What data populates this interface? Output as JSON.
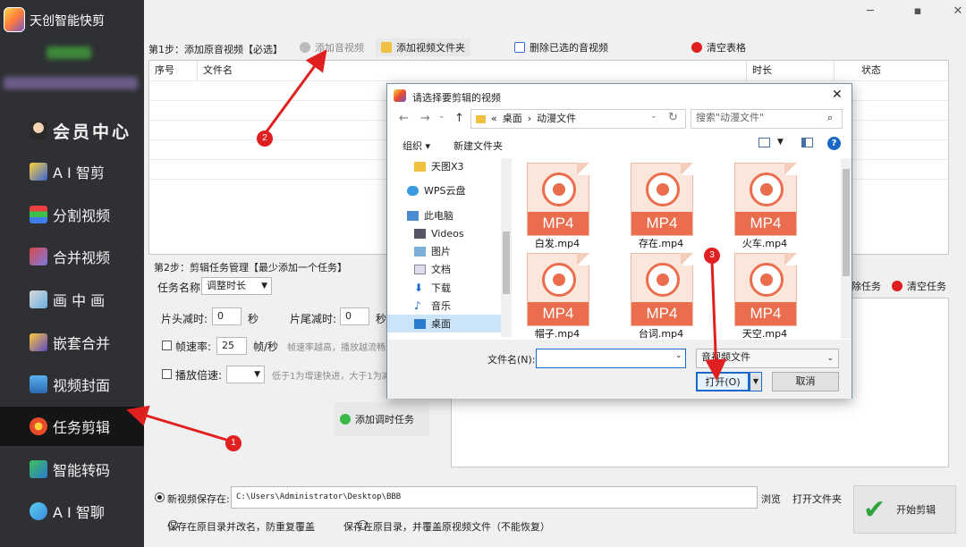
{
  "app": {
    "title": "天创智能快剪"
  },
  "sidebar": {
    "items": [
      {
        "label": "会员中心",
        "icon": "member-icon"
      },
      {
        "label": "A I 智剪",
        "icon": "ai-cut-icon"
      },
      {
        "label": "分割视频",
        "icon": "split-icon"
      },
      {
        "label": "合并视频",
        "icon": "merge-icon"
      },
      {
        "label": "画 中 画",
        "icon": "pip-icon"
      },
      {
        "label": "嵌套合并",
        "icon": "nest-icon"
      },
      {
        "label": "视频封面",
        "icon": "cover-icon"
      },
      {
        "label": "任务剪辑",
        "icon": "task-icon"
      },
      {
        "label": "智能转码",
        "icon": "transcode-icon"
      },
      {
        "label": "A I 智聊",
        "icon": "chat-icon"
      }
    ]
  },
  "step1": {
    "label": "第1步：添加原音视频【必选】",
    "add_av": "添加音视频",
    "add_folder": "添加视频文件夹",
    "delete_selected": "删除已选的音视频",
    "clear_table": "清空表格",
    "columns": [
      "序号",
      "文件名",
      "时长",
      "状态"
    ]
  },
  "step2": {
    "label": "第2步：剪辑任务管理【最少添加一个任务】",
    "task_name_label": "任务名称:",
    "task_name_value": "调整时长",
    "head_cut_label": "片头减时:",
    "head_cut_value": "0",
    "tail_cut_label": "片尾减时:",
    "tail_cut_value": "0",
    "sec": "秒",
    "frame_rate_label": "帧速率:",
    "frame_rate_value": "25",
    "frame_unit": "帧/秒",
    "frame_hint": "帧速率越高，播放越流畅，",
    "speed_label": "播放倍速:",
    "speed_hint": "低于1为增速快进，大于1为减",
    "add_task": "添加调时任务",
    "delete_task": "除任务",
    "clear_tasks": "清空任务"
  },
  "save": {
    "new_save_label": "新视频保存在:",
    "path": "C:\\Users\\Administrator\\Desktop\\BBB",
    "browse": "浏览",
    "open_folder": "打开文件夹",
    "option_rename": "保存在原目录并改名，防重复覆盖",
    "option_overwrite": "保存在原目录，并覆盖原视频文件（不能恢复）",
    "start": "开始剪辑"
  },
  "dialog": {
    "title": "请选择要剪辑的视频",
    "breadcrumb": [
      "«",
      "桌面",
      "›",
      "动漫文件"
    ],
    "search_placeholder": "搜索\"动漫文件\"",
    "organize": "组织",
    "new_folder": "新建文件夹",
    "tree": [
      {
        "label": "天图X3",
        "icon": "folder-icon"
      },
      {
        "label": "WPS云盘",
        "icon": "cloud-icon"
      },
      {
        "label": "此电脑",
        "icon": "computer-icon"
      },
      {
        "label": "Videos",
        "icon": "videos-icon"
      },
      {
        "label": "图片",
        "icon": "pictures-icon"
      },
      {
        "label": "文档",
        "icon": "documents-icon"
      },
      {
        "label": "下载",
        "icon": "download-icon"
      },
      {
        "label": "音乐",
        "icon": "music-icon"
      },
      {
        "label": "桌面",
        "icon": "desktop-icon"
      }
    ],
    "files": [
      {
        "name": "白发.mp4",
        "badge": "MP4"
      },
      {
        "name": "存在.mp4",
        "badge": "MP4"
      },
      {
        "name": "火车.mp4",
        "badge": "MP4"
      },
      {
        "name": "帽子.mp4",
        "badge": "MP4"
      },
      {
        "name": "台词.mp4",
        "badge": "MP4"
      },
      {
        "name": "天空.mp4",
        "badge": "MP4"
      }
    ],
    "filename_label": "文件名(N):",
    "filename_value": "",
    "filetype": "音视频文件",
    "open": "打开(O)",
    "cancel": "取消"
  },
  "annotations": [
    "1",
    "2",
    "3"
  ],
  "colors": {
    "sidebar_bg": "#2e3033",
    "active_bg": "#141516",
    "accent_red": "#e02020",
    "mp4_orange": "#ea6d4d"
  }
}
